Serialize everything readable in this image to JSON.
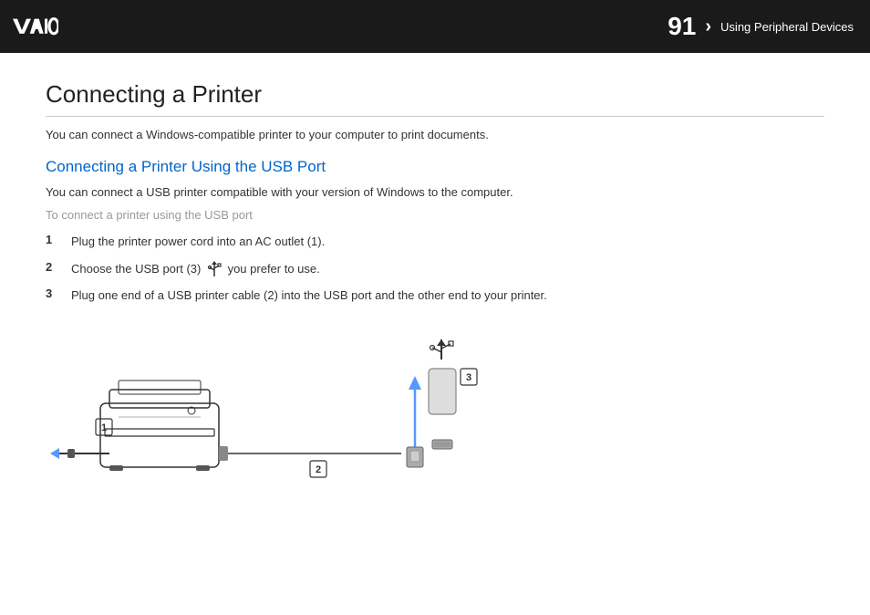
{
  "header": {
    "page_number": "91",
    "arrow": "N",
    "title": "Using Peripheral Devices"
  },
  "content": {
    "main_title": "Connecting a Printer",
    "intro_text": "You can connect a Windows-compatible printer to your computer to print documents.",
    "section_title": "Connecting a Printer Using the USB Port",
    "section_intro": "You can connect a USB printer compatible with your version of Windows to the computer.",
    "sub_title": "To connect a printer using the USB port",
    "steps": [
      {
        "number": "1",
        "text": "Plug the printer power cord into an AC outlet (1)."
      },
      {
        "number": "2",
        "text": "Choose the USB port (3)  you prefer to use."
      },
      {
        "number": "3",
        "text": "Plug one end of a USB printer cable (2) into the USB port and the other end to your printer."
      }
    ]
  }
}
